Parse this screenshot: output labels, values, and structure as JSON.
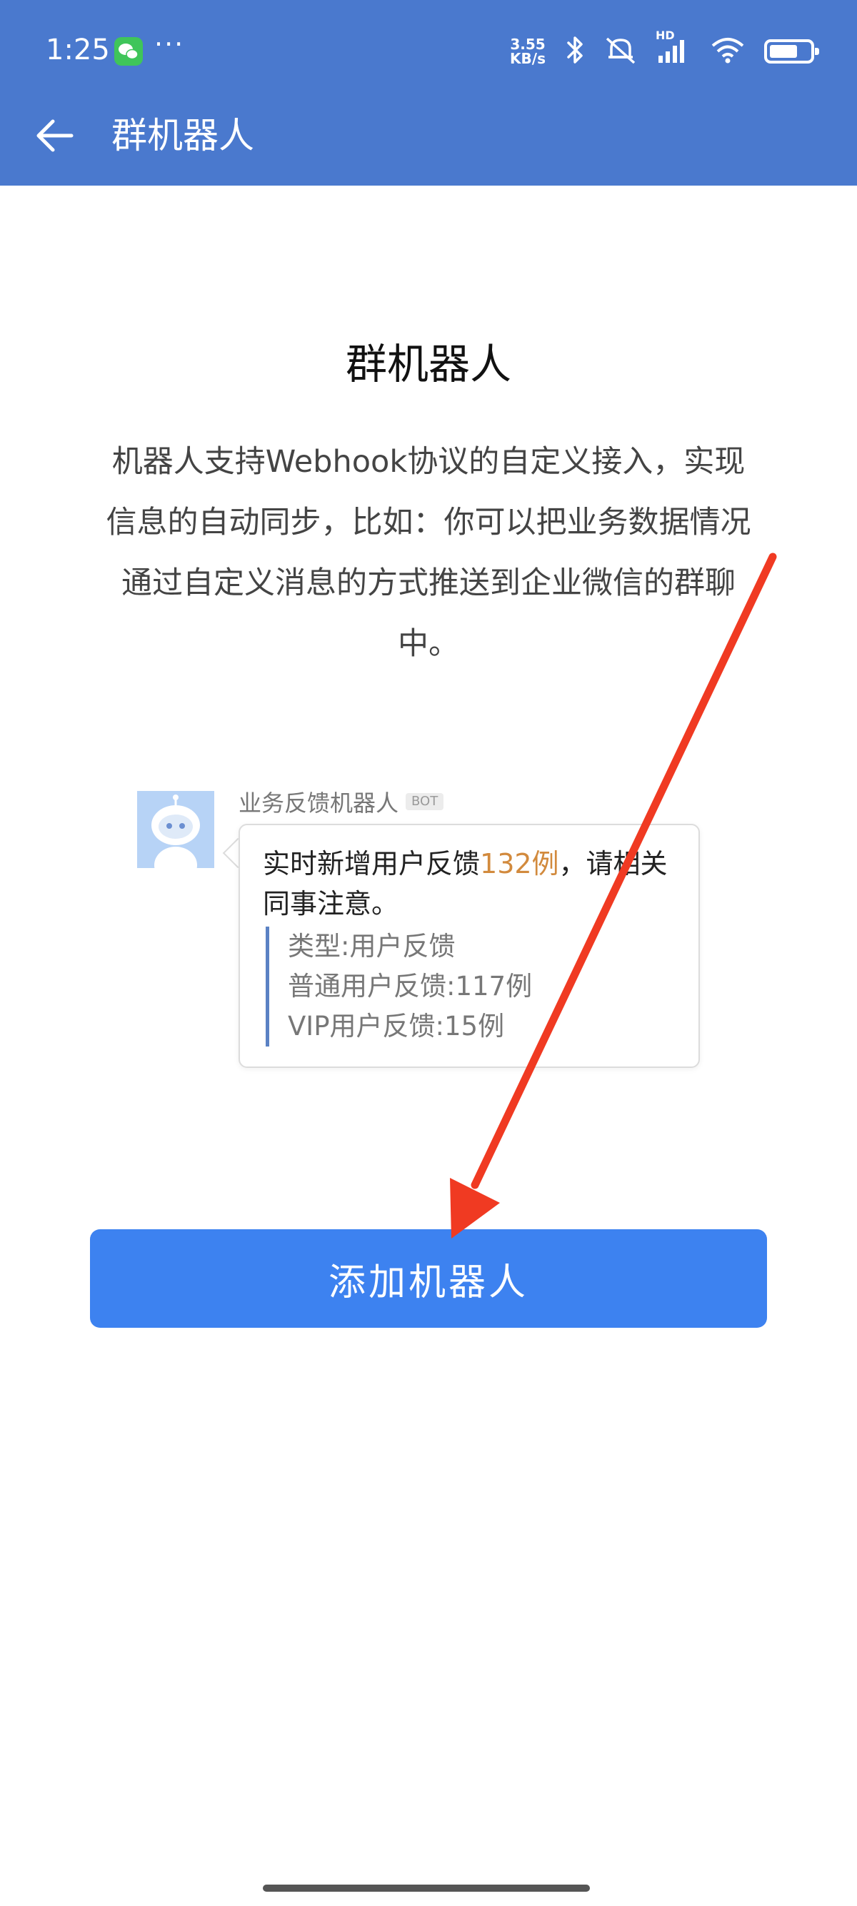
{
  "status_bar": {
    "time": "1:25",
    "more": "···",
    "net_speed_value": "3.55",
    "net_speed_unit": "KB/s",
    "hd": "HD",
    "icons": [
      "wechat-icon",
      "bluetooth-icon",
      "mute-icon",
      "signal-icon",
      "wifi-icon",
      "battery-icon"
    ]
  },
  "appbar": {
    "title": "群机器人"
  },
  "main": {
    "title": "群机器人",
    "description": "机器人支持Webhook协议的自定义接入，实现信息的自动同步，比如：你可以把业务数据情况通过自定义消息的方式推送到企业微信的群聊中。"
  },
  "preview": {
    "bot_name": "业务反馈机器人",
    "bot_tag": "BOT",
    "message_prefix": "实时新增用户反馈",
    "message_highlight": "132例",
    "message_suffix": "，请相关同事注意。",
    "details": [
      "类型:用户反馈",
      "普通用户反馈:117例",
      "VIP用户反馈:15例"
    ]
  },
  "button": {
    "label": "添加机器人"
  },
  "colors": {
    "appbar": "#4a79ce",
    "button": "#3d82f0",
    "highlight": "#d28a3d",
    "arrow": "#f03a22"
  }
}
